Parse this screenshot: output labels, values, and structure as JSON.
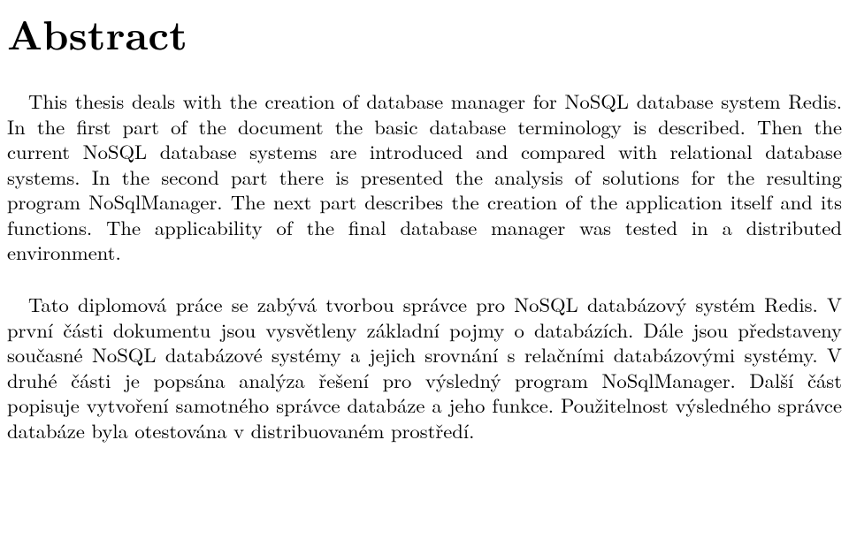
{
  "title": "Abstract",
  "para_en": "This thesis deals with the creation of database manager for NoSQL database system Redis. In the first part of the document the basic database terminology is described. Then the current NoSQL database systems are introduced and compared with relational database systems. In the second part there is presented the analysis of solutions for the resulting program NoSqlManager. The next part describes the creation of the application itself and its functions. The applicability of the final database manager was tested in a distributed environment.",
  "para_cs": "Tato diplomová práce se zabývá tvorbou správce pro NoSQL databázový systém Redis. V první části dokumentu jsou vysvětleny základní pojmy o databázích. Dále jsou představeny současné NoSQL databázové systémy a jejich srovnání s relačními databázovými systémy. V druhé části je popsána analýza řešení pro výsledný program NoSqlManager. Další část popisuje vytvoření samotného správce databáze a jeho funkce. Použitelnost výsledného správce databáze byla otestována v distribuovaném prostředí."
}
